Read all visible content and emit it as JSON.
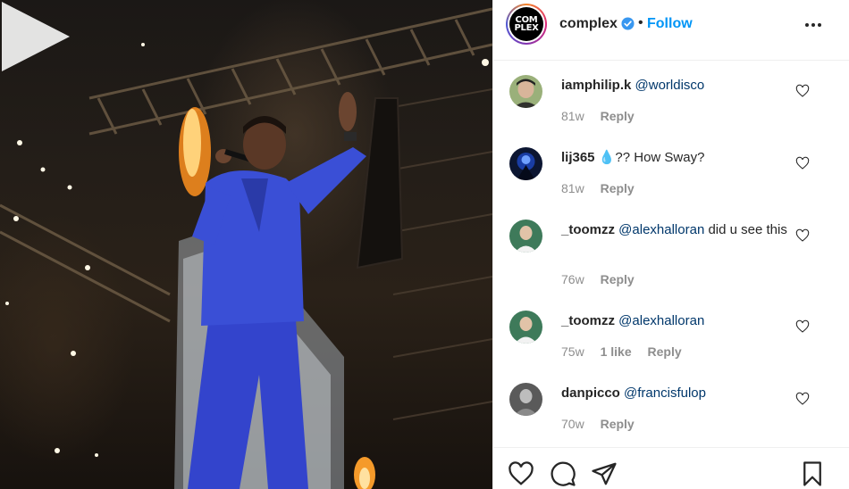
{
  "post": {
    "author": "complex",
    "follow_label": "Follow",
    "separator": "•",
    "logo_line1": "COM",
    "logo_line2": "PLEX"
  },
  "comments": [
    {
      "user": "iamphilip.k",
      "text": "",
      "mention": "@worldisco",
      "after": "",
      "time": "81w",
      "likes": "",
      "reply": "Reply"
    },
    {
      "user": "lij365",
      "text": "💧?? How Sway?",
      "mention": "",
      "after": "",
      "time": "81w",
      "likes": "",
      "reply": "Reply"
    },
    {
      "user": "_toomzz",
      "text": "",
      "mention": "@alexhalloran",
      "after": " did u see this",
      "time": "76w",
      "likes": "",
      "reply": "Reply"
    },
    {
      "user": "_toomzz",
      "text": "",
      "mention": "@alexhalloran",
      "after": "",
      "time": "75w",
      "likes": "1 like",
      "reply": "Reply"
    },
    {
      "user": "danpicco",
      "text": "",
      "mention": "@francisfulop",
      "after": "",
      "time": "70w",
      "likes": "",
      "reply": "Reply"
    }
  ],
  "icons": {
    "verified": "verified-badge-icon",
    "more": "more-options-icon",
    "like": "heart-icon",
    "comment": "comment-bubble-icon",
    "share": "paper-plane-icon",
    "save": "bookmark-icon",
    "play": "play-icon"
  },
  "colors": {
    "accent": "#0095f6",
    "mention": "#00376b",
    "suit": "#3a4fd6",
    "text": "#262626",
    "muted": "#8e8e8e"
  }
}
